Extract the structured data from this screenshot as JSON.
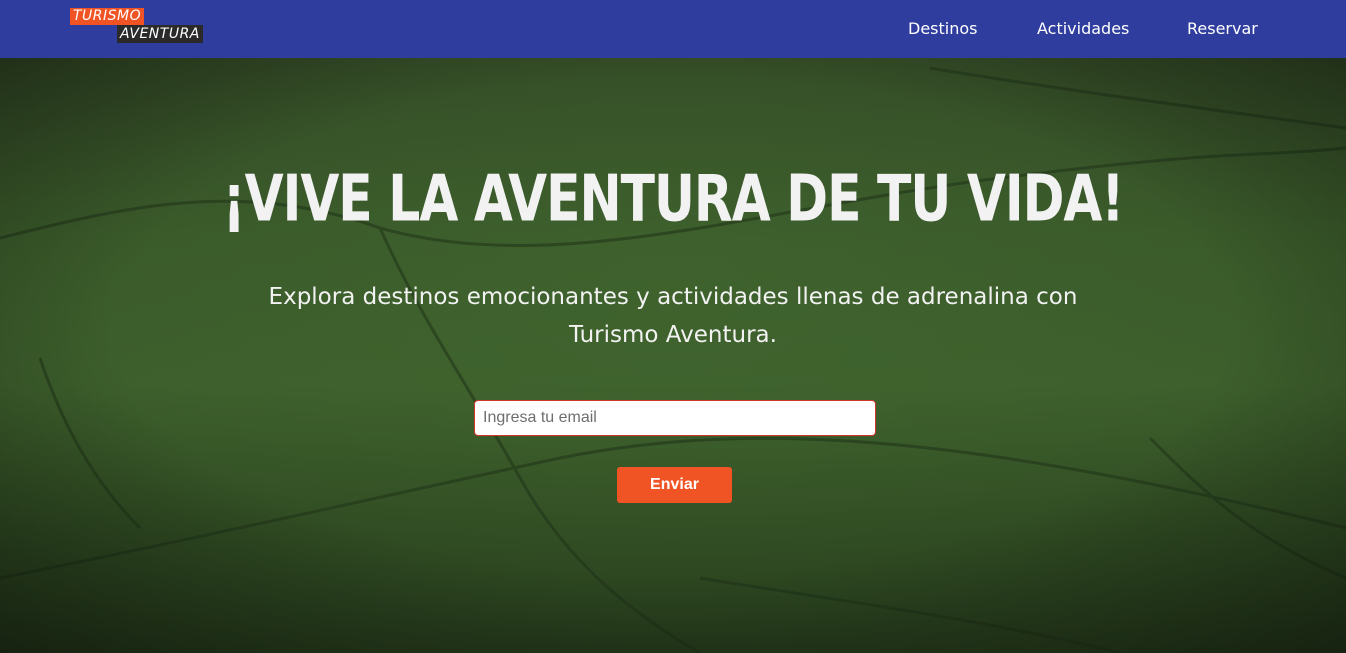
{
  "brand": {
    "logo_top": "TURISMO",
    "logo_bottom": "AVENTURA"
  },
  "nav": {
    "items": [
      {
        "label": "Destinos"
      },
      {
        "label": "Actividades"
      },
      {
        "label": "Reservar"
      }
    ]
  },
  "hero": {
    "title": "¡VIVE LA AVENTURA DE TU VIDA!",
    "subtitle": "Explora destinos emocionantes y actividades llenas de adrenalina con Turismo Aventura.",
    "email_placeholder": "Ingresa tu email",
    "email_value": "",
    "submit_label": "Enviar"
  },
  "colors": {
    "navbar": "#2f3e9e",
    "accent": "#f05425",
    "hero_green": "#3a5a2a"
  }
}
